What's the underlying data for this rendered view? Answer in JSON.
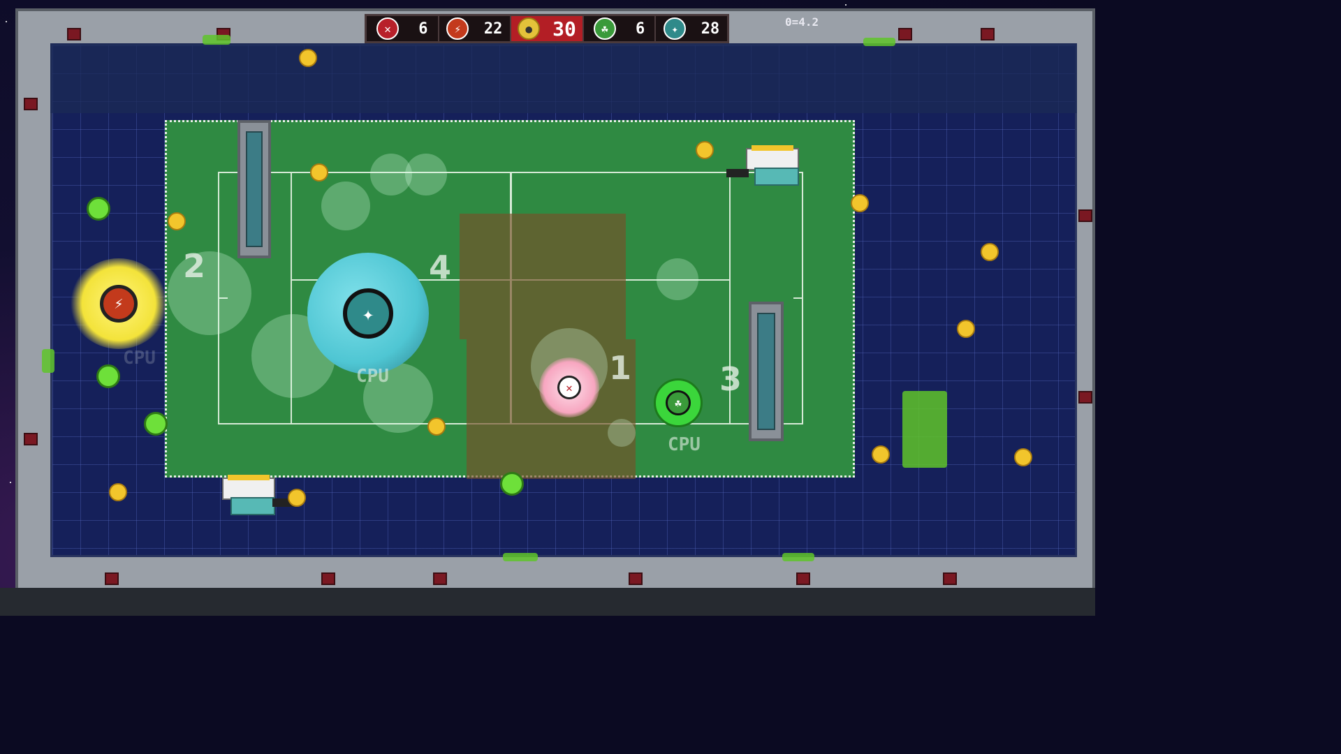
{
  "hud": {
    "teams": [
      {
        "icon": "crossed-bones-icon",
        "color": "#b8202a",
        "score": "6"
      },
      {
        "icon": "lightning-bolt-icon",
        "color": "#c33a1c",
        "score": "22"
      },
      {
        "icon": "leaf-icon",
        "color": "#3a9a3a",
        "score": "6"
      },
      {
        "icon": "star-compass-icon",
        "color": "#2f8a8a",
        "score": "28"
      }
    ],
    "timer": {
      "icon": "tennis-ball-icon",
      "value": "30"
    }
  },
  "ping_readout": "0=4.2",
  "players": [
    {
      "number": "1",
      "color": "#f7a6c0"
    },
    {
      "number": "2",
      "color": "#f3e33a"
    },
    {
      "number": "3",
      "color": "#3bd63b"
    },
    {
      "number": "4",
      "color": "#4fc6d3"
    }
  ],
  "cpu_labels": [
    "CPU",
    "CPU",
    "CPU"
  ],
  "colors": {
    "court": "#2f8a42",
    "floor": "#15205a",
    "wall": "#9aa0a8",
    "ball": "#f2c52c",
    "powerup_ball": "#6ee03a"
  }
}
